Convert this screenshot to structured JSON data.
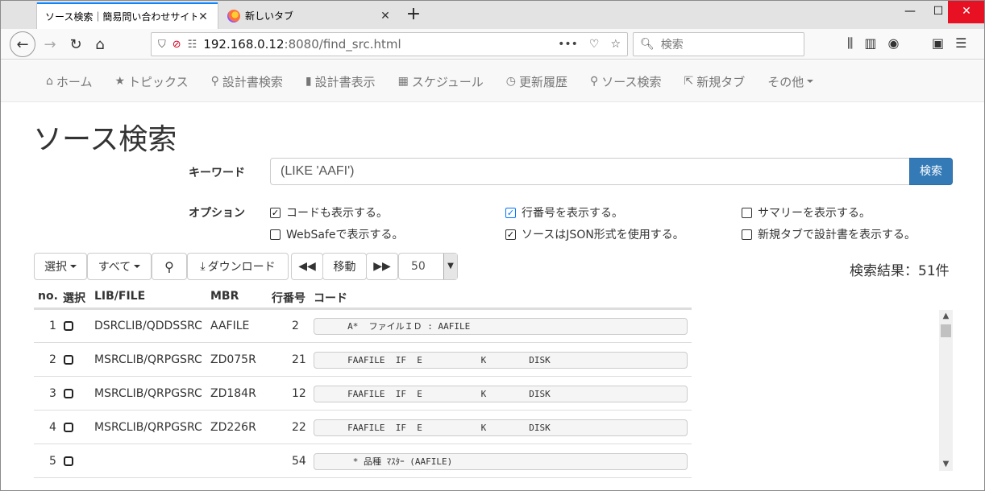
{
  "browser": {
    "tabs": [
      {
        "title": "ソース検索｜簡易問い合わせサイト",
        "active": true
      },
      {
        "title": "新しいタブ",
        "active": false
      }
    ],
    "url_host": "192.168.0.12",
    "url_rest": ":8080/find_src.html",
    "search_placeholder": "検索"
  },
  "site_nav": {
    "items": [
      {
        "icon": "home-icon",
        "label": "ホーム"
      },
      {
        "icon": "star-icon",
        "label": "トピックス"
      },
      {
        "icon": "search-icon",
        "label": "設計書検索"
      },
      {
        "icon": "book-icon",
        "label": "設計書表示"
      },
      {
        "icon": "calendar-icon",
        "label": "スケジュール"
      },
      {
        "icon": "clock-icon",
        "label": "更新履歴"
      },
      {
        "icon": "search-icon",
        "label": "ソース検索"
      },
      {
        "icon": "external-link-icon",
        "label": "新規タブ"
      },
      {
        "icon": "",
        "label": "その他"
      }
    ]
  },
  "page": {
    "title": "ソース検索",
    "keyword_label": "キーワード",
    "keyword_value": "(LIKE 'AAFI')",
    "search_button": "検索",
    "options_label": "オプション",
    "options": [
      {
        "label": "コードも表示する。",
        "checked": true
      },
      {
        "label": "行番号を表示する。",
        "checked": true
      },
      {
        "label": "サマリーを表示する。",
        "checked": false
      },
      {
        "label": "WebSafeで表示する。",
        "checked": false
      },
      {
        "label": "ソースはJSON形式を使用する。",
        "checked": true
      },
      {
        "label": "新規タブで設計書を表示する。",
        "checked": false
      }
    ]
  },
  "toolbar": {
    "select_label": "選択",
    "all_label": "すべて",
    "download_label": "ダウンロード",
    "move_label": "移動",
    "page_size": "50",
    "result_count": "検索結果：51件"
  },
  "table": {
    "headers": {
      "no": "no.",
      "select": "選択",
      "lib": "LIB/FILE",
      "mbr": "MBR",
      "line": "行番号",
      "code": "コード"
    },
    "rows": [
      {
        "no": "1",
        "lib": "DSRCLIB/QDDSSRC",
        "mbr": "AAFILE",
        "line": "2",
        "code": "     A*  ファイルＩＤ : AAFILE"
      },
      {
        "no": "2",
        "lib": "MSRCLIB/QRPGSRC",
        "mbr": "ZD075R",
        "line": "21",
        "code": "     FAAFILE  IF  E           K        DISK"
      },
      {
        "no": "3",
        "lib": "MSRCLIB/QRPGSRC",
        "mbr": "ZD184R",
        "line": "12",
        "code": "     FAAFILE  IF  E           K        DISK"
      },
      {
        "no": "4",
        "lib": "MSRCLIB/QRPGSRC",
        "mbr": "ZD226R",
        "line": "22",
        "code": "     FAAFILE  IF  E           K        DISK"
      },
      {
        "no": "5",
        "lib": "",
        "mbr": "",
        "line": "54",
        "code": "      * 品種 ﾏｽﾀｰ (AAFILE)"
      }
    ]
  }
}
